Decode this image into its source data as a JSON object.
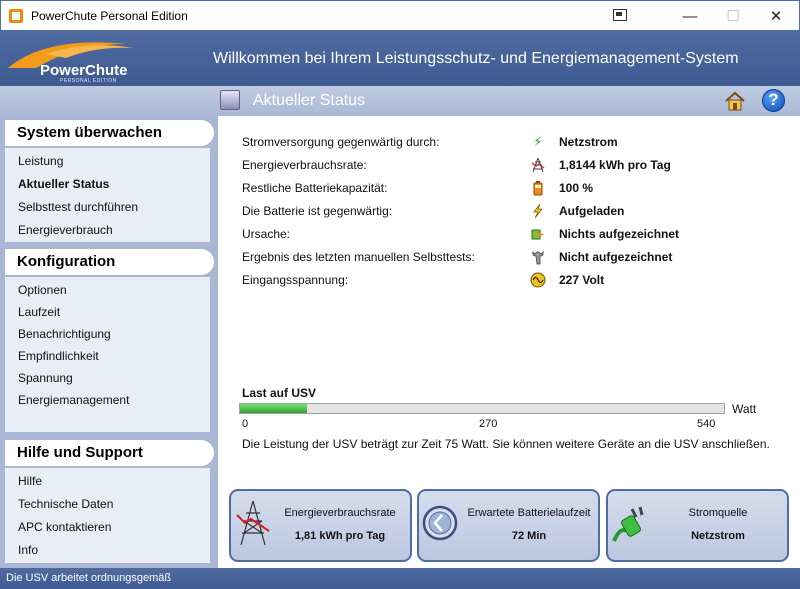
{
  "window": {
    "title": "PowerChute Personal Edition",
    "minimize": "—",
    "maximize": "☐",
    "close": "✕"
  },
  "banner": {
    "logo_text": "PowerChute",
    "logo_sub": "PERSONAL EDITION",
    "title": "Willkommen bei Ihrem Leistungsschutz- und Energiemanagement-System"
  },
  "subheader": {
    "title": "Aktueller Status",
    "help": "?"
  },
  "sidebar": {
    "sections": [
      {
        "title": "System überwachen",
        "items": [
          "Leistung",
          "Aktueller Status",
          "Selbsttest durchführen",
          "Energieverbrauch"
        ]
      },
      {
        "title": "Konfiguration",
        "items": [
          "Optionen",
          "Laufzeit",
          "Benachrichtigung",
          "Empfindlichkeit",
          "Spannung",
          "Energiemanagement"
        ]
      },
      {
        "title": "Hilfe und Support",
        "items": [
          "Hilfe",
          "Technische Daten",
          "APC kontaktieren",
          "Info"
        ]
      }
    ],
    "active_item": "Aktueller Status"
  },
  "status": {
    "rows": [
      {
        "label": "Stromversorgung gegenwärtig durch:",
        "icon": "plug-icon",
        "value": "Netzstrom"
      },
      {
        "label": "Energieverbrauchsrate:",
        "icon": "tower-icon",
        "value": "1,8144 kWh pro Tag"
      },
      {
        "label": "Restliche Batteriekapazität:",
        "icon": "battery-icon",
        "value": "100 %"
      },
      {
        "label": "Die Batterie ist gegenwärtig:",
        "icon": "lightning-icon",
        "value": "Aufgeladen"
      },
      {
        "label": "Ursache:",
        "icon": "arrow-icon",
        "value": "Nichts aufgezeichnet"
      },
      {
        "label": "Ergebnis des letzten manuellen Selbsttests:",
        "icon": "wrench-icon",
        "value": "Nicht aufgezeichnet"
      },
      {
        "label": "Eingangsspannung:",
        "icon": "sine-wave-icon",
        "value": "227 Volt"
      }
    ]
  },
  "load": {
    "title": "Last auf USV",
    "value_watt": 75,
    "max_watt": 540,
    "ticks": [
      "0",
      "270",
      "540"
    ],
    "unit": "Watt",
    "description": "Die Leistung der USV beträgt zur Zeit 75 Watt. Sie können weitere Geräte an die USV anschließen."
  },
  "cards": [
    {
      "label": "Energieverbrauchsrate",
      "value": "1,81 kWh pro Tag",
      "icon": "tower-icon"
    },
    {
      "label": "Erwartete Batterielaufzeit",
      "value": "72 Min",
      "icon": "clock-icon"
    },
    {
      "label": "Stromquelle",
      "value": "Netzstrom",
      "icon": "plug-icon"
    }
  ],
  "statusbar": {
    "text": "Die USV arbeitet ordnungsgemäß"
  },
  "colors": {
    "banner": "#4a66a0",
    "sidebar": "#aab7d4",
    "load_fill": "#3cb43c"
  }
}
